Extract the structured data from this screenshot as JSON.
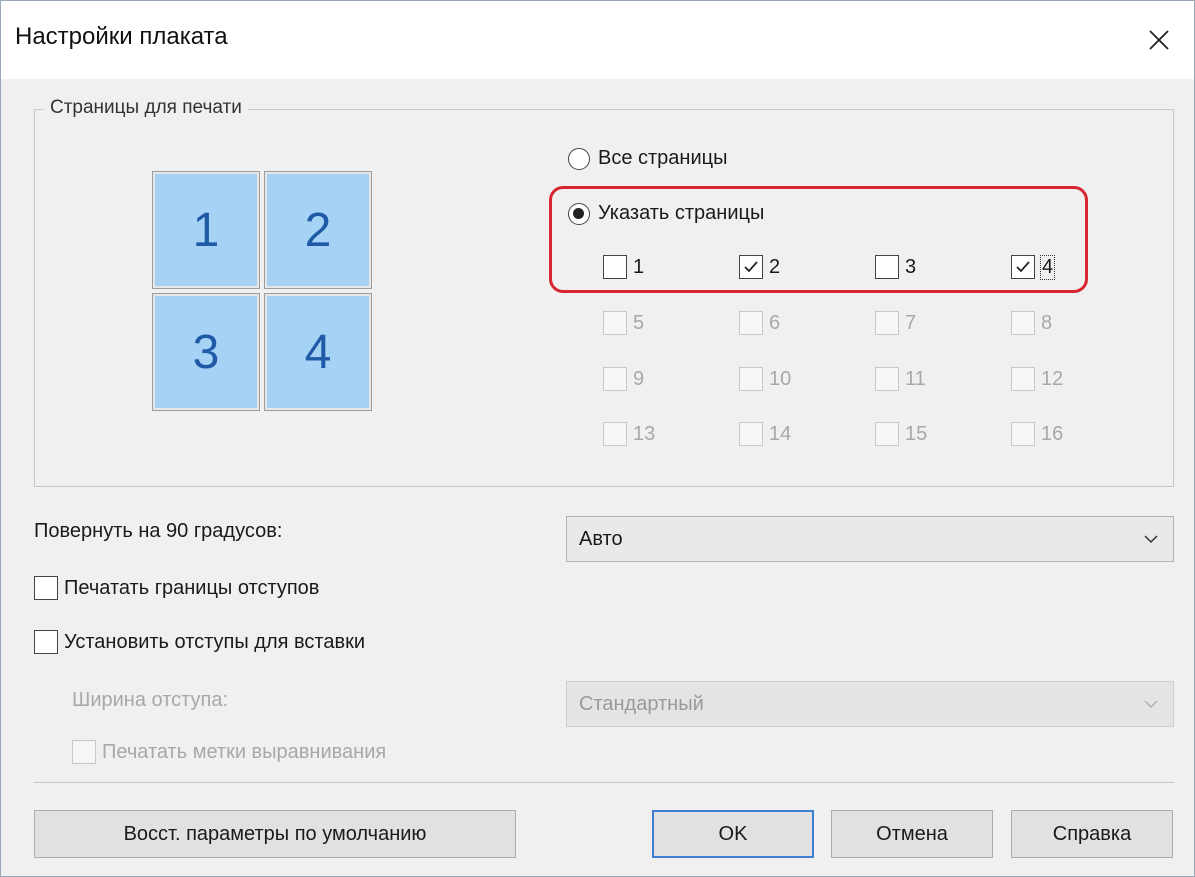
{
  "window": {
    "title": "Настройки плаката"
  },
  "pages_group": {
    "label": "Страницы для печати",
    "preview_tiles": [
      "1",
      "2",
      "3",
      "4"
    ],
    "radio_all": {
      "label": "Все страницы",
      "checked": false
    },
    "radio_specify": {
      "label": "Указать страницы",
      "checked": true
    },
    "pages": [
      {
        "label": "1",
        "checked": false,
        "enabled": true
      },
      {
        "label": "2",
        "checked": true,
        "enabled": true
      },
      {
        "label": "3",
        "checked": false,
        "enabled": true
      },
      {
        "label": "4",
        "checked": true,
        "enabled": true
      },
      {
        "label": "5",
        "checked": false,
        "enabled": false
      },
      {
        "label": "6",
        "checked": false,
        "enabled": false
      },
      {
        "label": "7",
        "checked": false,
        "enabled": false
      },
      {
        "label": "8",
        "checked": false,
        "enabled": false
      },
      {
        "label": "9",
        "checked": false,
        "enabled": false
      },
      {
        "label": "10",
        "checked": false,
        "enabled": false
      },
      {
        "label": "11",
        "checked": false,
        "enabled": false
      },
      {
        "label": "12",
        "checked": false,
        "enabled": false
      },
      {
        "label": "13",
        "checked": false,
        "enabled": false
      },
      {
        "label": "14",
        "checked": false,
        "enabled": false
      },
      {
        "label": "15",
        "checked": false,
        "enabled": false
      },
      {
        "label": "16",
        "checked": false,
        "enabled": false
      }
    ]
  },
  "rotate": {
    "label": "Повернуть на 90 градусов:",
    "value": "Авто"
  },
  "print_margins": {
    "label": "Печатать границы отступов",
    "checked": false
  },
  "set_margins": {
    "label": "Установить отступы для вставки",
    "checked": false
  },
  "margin_width": {
    "label": "Ширина отступа:",
    "value": "Стандартный"
  },
  "align_marks": {
    "label": "Печатать метки выравнивания",
    "checked": false
  },
  "buttons": {
    "restore": "Восст. параметры по умолчанию",
    "ok": "OK",
    "cancel": "Отмена",
    "help": "Справка"
  },
  "colors": {
    "highlight": "#d6262f",
    "tile": "#a6d2f5",
    "tile_text": "#1f5aa6",
    "default_button_border": "#3c7fd0"
  }
}
